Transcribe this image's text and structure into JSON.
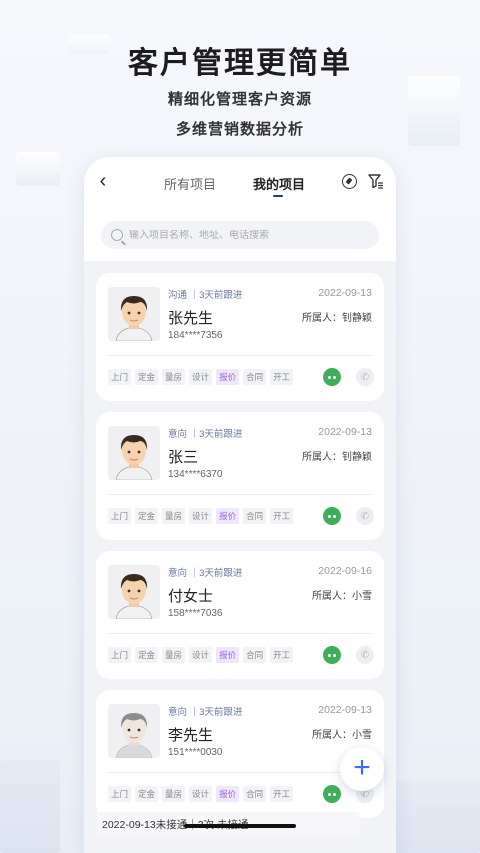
{
  "hero": {
    "title": "客户管理更简单",
    "subtitle1": "精细化管理客户资源",
    "subtitle2": "多维营销数据分析"
  },
  "header": {
    "tabs": [
      "所有项目",
      "我的项目"
    ],
    "active_tab": "我的项目",
    "search_placeholder": "输入项目名称、地址、电话搜索"
  },
  "stages": [
    "上门",
    "定金",
    "量房",
    "设计",
    "报价",
    "合同",
    "开工"
  ],
  "active_stage": "报价",
  "customers": [
    {
      "status": "沟通 ｜3天前跟进",
      "date": "2022-09-13",
      "name": "张先生",
      "owner": "所属人：钊静颖",
      "phone": "184****7356"
    },
    {
      "status": "意向 ｜3天前跟进",
      "date": "2022-09-13",
      "name": "张三",
      "owner": "所属人：钊静颖",
      "phone": "134****6370"
    },
    {
      "status": "意向 ｜3天前跟进",
      "date": "2022-09-16",
      "name": "付女士",
      "owner": "所属人：小雪",
      "phone": "158****7036"
    },
    {
      "status": "意向 ｜3天前跟进",
      "date": "2022-09-13",
      "name": "李先生",
      "owner": "所属人：小雪",
      "phone": "151****0030"
    }
  ],
  "followup": "2022-09-13未接通｜3次 未接通",
  "fab_label": "+",
  "colors": {
    "accent": "#3b6ef0",
    "chat": "#3fae5b",
    "stage_active": "#9b6ad6"
  }
}
